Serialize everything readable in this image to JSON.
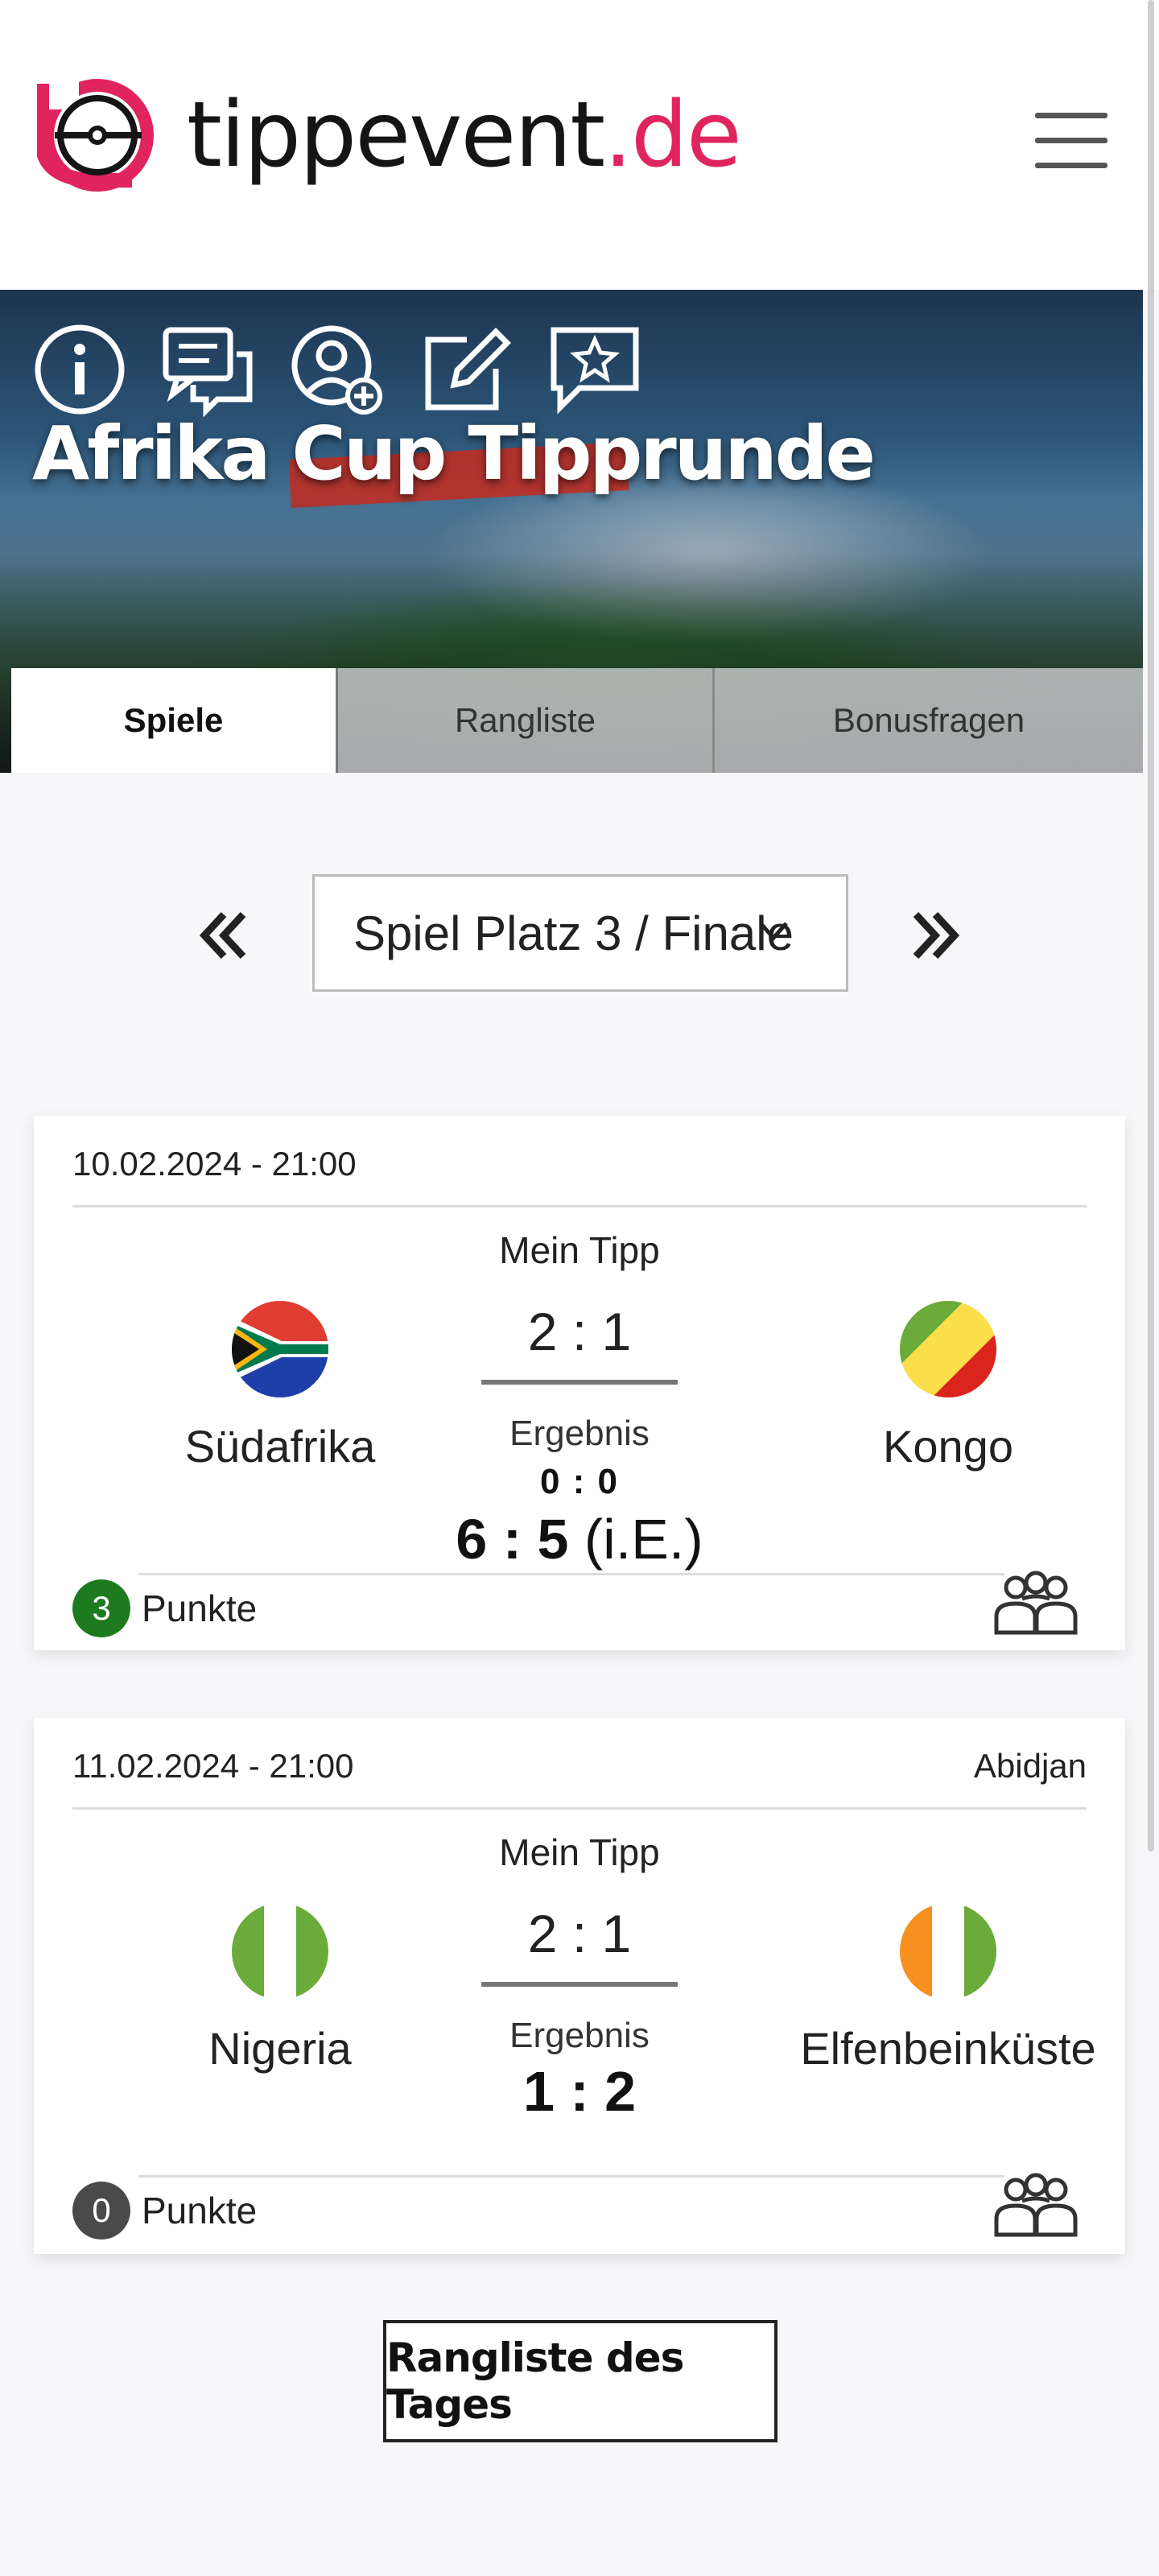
{
  "header": {
    "logo_main": "tippevent",
    "logo_tld": ".de",
    "menu_icon": "hamburger-menu-icon"
  },
  "hero": {
    "title": "Afrika Cup Tipprunde",
    "icons": [
      "info-icon",
      "chat-icon",
      "add-user-icon",
      "edit-icon",
      "star-message-icon"
    ]
  },
  "tabs": [
    {
      "label": "Spiele",
      "active": true
    },
    {
      "label": "Rangliste",
      "active": false
    },
    {
      "label": "Bonusfragen",
      "active": false
    }
  ],
  "round_selector": {
    "value": "Spiel Platz 3 / Finale",
    "prev_icon": "double-chevron-left-icon",
    "next_icon": "double-chevron-right-icon"
  },
  "matches": [
    {
      "datetime": "10.02.2024 - 21:00",
      "venue": "",
      "my_tip_label": "Mein Tipp",
      "home": {
        "name": "Südafrika",
        "flag": "south-africa-flag-icon"
      },
      "away": {
        "name": "Kongo",
        "flag": "congo-flag-icon"
      },
      "tip": "2 : 1",
      "result_label": "Ergebnis",
      "result_regular": "0 : 0",
      "result_final": "6 : 5",
      "result_suffix": "(i.E.)",
      "points": "3",
      "points_label": "Punkte",
      "points_color": "#1e7a1e"
    },
    {
      "datetime": "11.02.2024 - 21:00",
      "venue": "Abidjan",
      "my_tip_label": "Mein Tipp",
      "home": {
        "name": "Nigeria",
        "flag": "nigeria-flag-icon"
      },
      "away": {
        "name": "Elfenbeinküste",
        "flag": "ivory-coast-flag-icon"
      },
      "tip": "2 : 1",
      "result_label": "Ergebnis",
      "result_final": "1 : 2",
      "points": "0",
      "points_label": "Punkte",
      "points_color": "#4a4a4a"
    }
  ],
  "day_ranking_button": "Rangliste des Tages"
}
